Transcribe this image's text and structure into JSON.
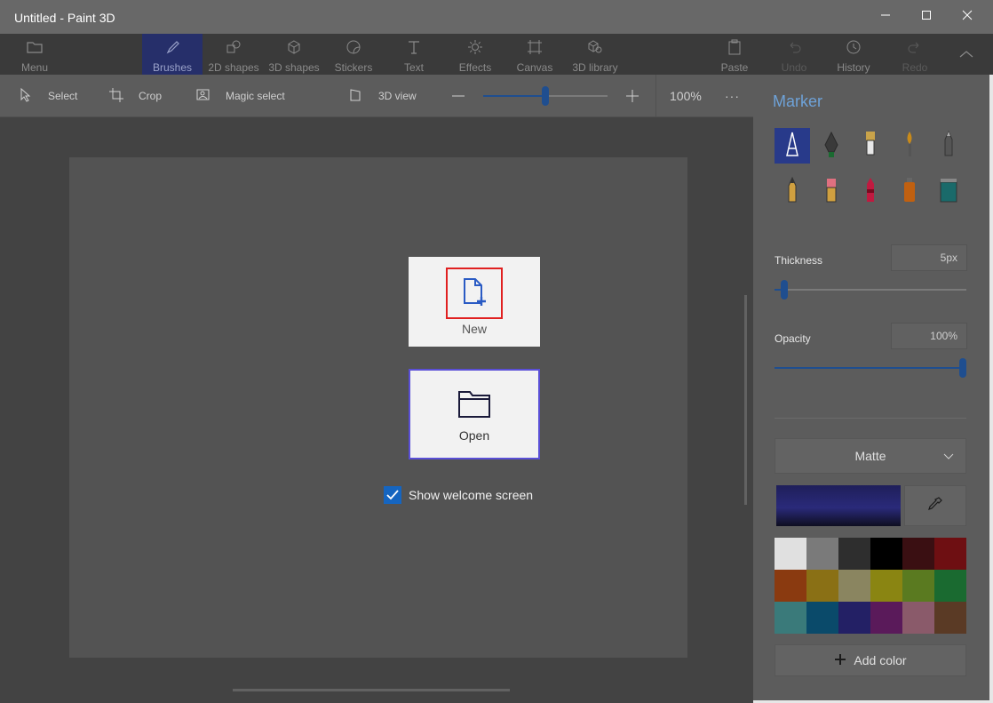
{
  "window": {
    "title": "Untitled - Paint 3D"
  },
  "ribbon": {
    "menu_label": "Menu",
    "tabs": [
      {
        "label": "Brushes",
        "icon": "brush-icon"
      },
      {
        "label": "2D shapes",
        "icon": "2d-shapes-icon"
      },
      {
        "label": "3D shapes",
        "icon": "3d-shapes-icon"
      },
      {
        "label": "Stickers",
        "icon": "stickers-icon"
      },
      {
        "label": "Text",
        "icon": "text-icon"
      },
      {
        "label": "Effects",
        "icon": "effects-icon"
      },
      {
        "label": "Canvas",
        "icon": "canvas-icon"
      },
      {
        "label": "3D library",
        "icon": "3d-library-icon"
      }
    ],
    "paste_label": "Paste",
    "undo_label": "Undo",
    "history_label": "History",
    "redo_label": "Redo"
  },
  "toolbar": {
    "select_label": "Select",
    "crop_label": "Crop",
    "magic_select_label": "Magic select",
    "view_3d_label": "3D view",
    "zoom_value": "100%",
    "zoom_level": 0.5,
    "more_label": "···"
  },
  "welcome": {
    "new_label": "New",
    "open_label": "Open",
    "show_welcome_label": "Show welcome screen",
    "show_welcome_checked": true
  },
  "panel": {
    "title": "Marker",
    "brushes": [
      "marker-icon",
      "calligraphy-pen-icon",
      "oil-brush-icon",
      "watercolor-icon",
      "pixel-pen-icon",
      "pencil-icon",
      "eraser-icon",
      "crayon-icon",
      "spray-can-icon",
      "fill-icon"
    ],
    "thickness_label": "Thickness",
    "thickness_value": "5px",
    "thickness_level": 0.05,
    "opacity_label": "Opacity",
    "opacity_value": "100%",
    "opacity_level": 1.0,
    "finish_value": "Matte",
    "current_color": "#2a2a7a",
    "palette": [
      "#e0e0e0",
      "#7a7a7a",
      "#2e2e2e",
      "#000000",
      "#3a0f12",
      "#6e0f12",
      "#8a3a10",
      "#8a7015",
      "#8a8560",
      "#8a8512",
      "#5a7a20",
      "#1a6a30",
      "#3a7a7a",
      "#0a4a6a",
      "#232065",
      "#5a1a5a",
      "#8a5a6a",
      "#5a3a25"
    ],
    "add_color_label": "Add color"
  },
  "colors": {
    "accent": "#1f4e8f",
    "highlight_box": "#e02020"
  }
}
